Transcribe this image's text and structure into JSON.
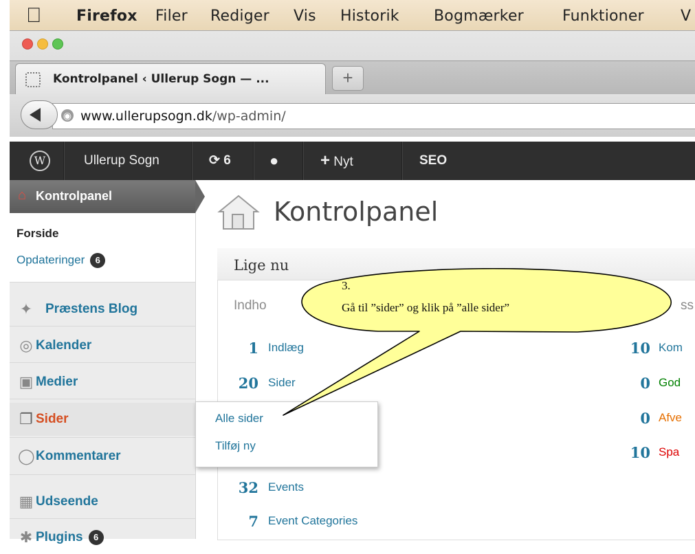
{
  "menubar": {
    "app": "Firefox",
    "items": [
      "Filer",
      "Rediger",
      "Vis",
      "Historik",
      "Bogmærker",
      "Funktioner",
      "V"
    ]
  },
  "tab": {
    "title": "Kontrolpanel ‹ Ullerup Sogn — ..."
  },
  "newtab": "+",
  "url": {
    "domain": "www.ullerupsogn.dk",
    "path": "/wp-admin/"
  },
  "adminbar": {
    "site": "Ullerup Sogn",
    "updates": "6",
    "new": "Nyt",
    "seo": "SEO"
  },
  "sidebar": {
    "dashboard": "Kontrolpanel",
    "forside": "Forside",
    "opdateringer": "Opdateringer",
    "opd_count": "6",
    "items": [
      "Præstens Blog",
      "Kalender",
      "Medier",
      "Sider",
      "Kommentarer",
      "Udseende",
      "Plugins"
    ],
    "plugins_count": "6"
  },
  "flyout": {
    "all": "Alle sider",
    "add": "Tilføj ny"
  },
  "main": {
    "title": "Kontrolpanel",
    "box_title": "Lige nu",
    "sub_left": "Indho",
    "sub_right": "ss",
    "left_rows": [
      {
        "num": "1",
        "label": "Indlæg"
      },
      {
        "num": "20",
        "label": "Sider"
      },
      {
        "num": "32",
        "label": "Events"
      },
      {
        "num": "7",
        "label": "Event Categories"
      }
    ],
    "right_rows": [
      {
        "num": "10",
        "label": "Kom",
        "color": "#21759b"
      },
      {
        "num": "0",
        "label": "God",
        "color": "#008000"
      },
      {
        "num": "0",
        "label": "Afve",
        "color": "#e66f00"
      },
      {
        "num": "10",
        "label": "Spa",
        "color": "#dd0000"
      }
    ]
  },
  "callout": {
    "step": "3.",
    "text": "Gå til ”sider” og klik på ”alle sider”"
  },
  "colors": {
    "wp_link": "#21759b",
    "callout_fill": "#ffff99",
    "adminbar": "#2f2f2f"
  }
}
